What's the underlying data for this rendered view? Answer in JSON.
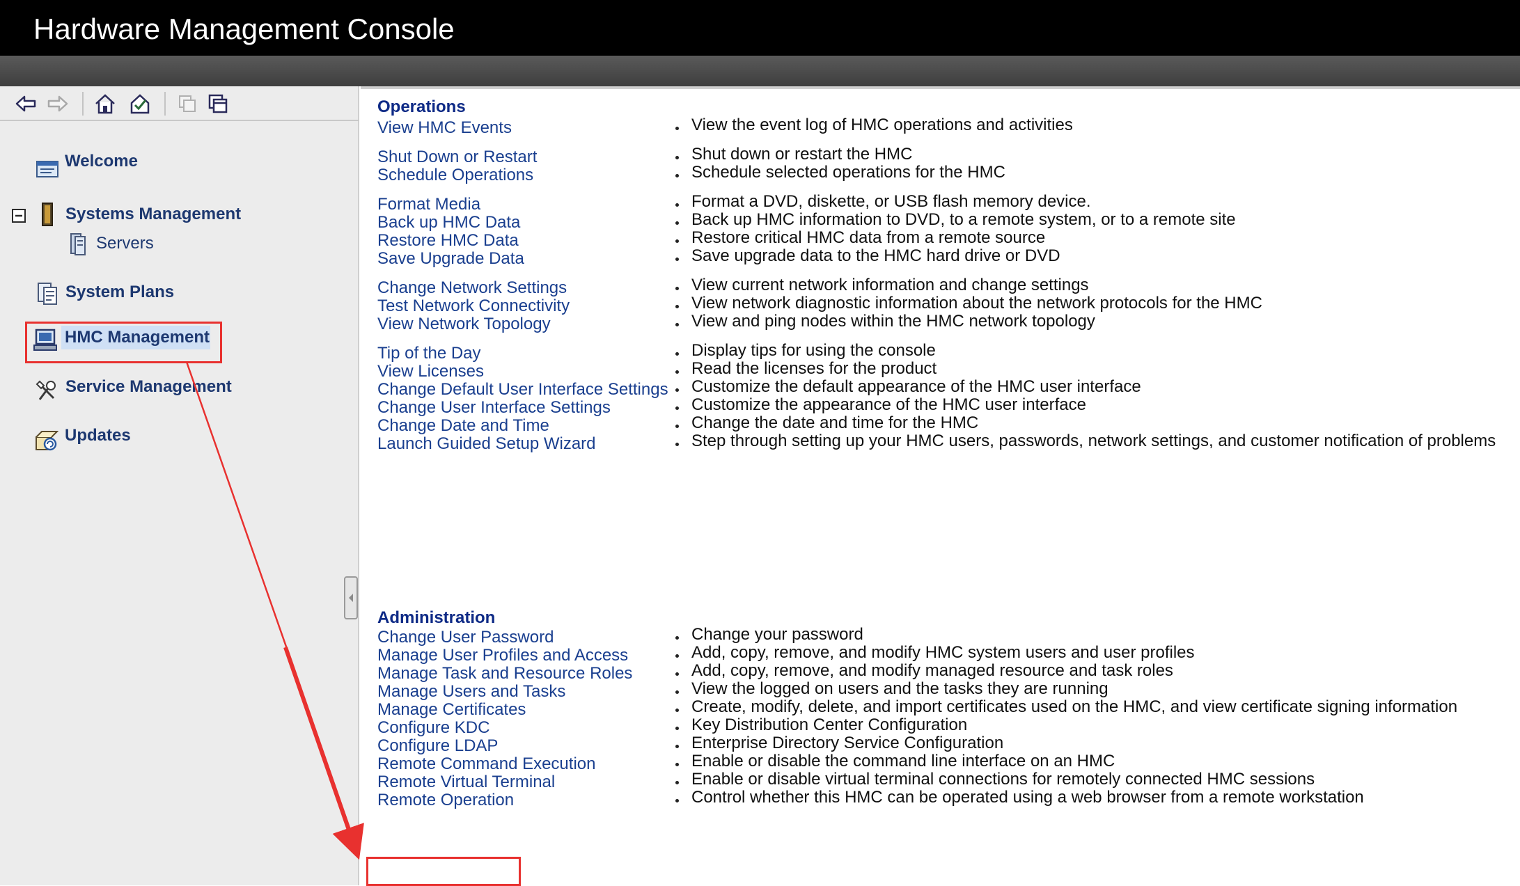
{
  "window": {
    "title": "Hardware Management Console"
  },
  "toolbar": {
    "icons": [
      "back-arrow-icon",
      "forward-arrow-icon",
      "home-icon",
      "favorites-check-icon",
      "tile-windows-icon",
      "cascade-windows-icon"
    ]
  },
  "sidebar": {
    "welcome": "Welcome",
    "systems_management": "Systems Management",
    "servers": "Servers",
    "system_plans": "System Plans",
    "hmc_management": "HMC Management",
    "service_management": "Service Management",
    "updates": "Updates",
    "selected": "HMC Management"
  },
  "operations": {
    "heading": "Operations",
    "groups": [
      [
        {
          "task": "View HMC Events",
          "desc": "View the event log of HMC operations and activities"
        }
      ],
      [
        {
          "task": "Shut Down or Restart",
          "desc": "Shut down or restart the HMC"
        },
        {
          "task": "Schedule Operations",
          "desc": "Schedule selected operations for the HMC"
        }
      ],
      [
        {
          "task": "Format Media",
          "desc": "Format a DVD, diskette, or USB flash memory device."
        },
        {
          "task": "Back up HMC Data",
          "desc": "Back up HMC information to DVD, to a remote system, or to a remote site"
        },
        {
          "task": "Restore HMC Data",
          "desc": "Restore critical HMC data from a remote source"
        },
        {
          "task": "Save Upgrade Data",
          "desc": "Save upgrade data to the HMC hard drive or DVD"
        }
      ],
      [
        {
          "task": "Change Network Settings",
          "desc": "View current network information and change settings"
        },
        {
          "task": "Test Network Connectivity",
          "desc": "View network diagnostic information about the network protocols for the HMC"
        },
        {
          "task": "View Network Topology",
          "desc": "View and ping nodes within the HMC network topology"
        }
      ],
      [
        {
          "task": "Tip of the Day",
          "desc": "Display tips for using the console"
        },
        {
          "task": "View Licenses",
          "desc": "Read the licenses for the product"
        },
        {
          "task": "Change Default User Interface Settings",
          "desc": "Customize the default appearance of the HMC user interface"
        },
        {
          "task": "Change User Interface Settings",
          "desc": "Customize the appearance of the HMC user interface"
        },
        {
          "task": "Change Date and Time",
          "desc": "Change the date and time for the HMC"
        },
        {
          "task": "Launch Guided Setup Wizard",
          "desc": "Step through setting up your HMC users, passwords, network settings, and customer notification of problems"
        }
      ]
    ]
  },
  "administration": {
    "heading": "Administration",
    "items": [
      {
        "task": "Change User Password",
        "desc": "Change your password"
      },
      {
        "task": "Manage User Profiles and Access",
        "desc": "Add, copy, remove, and modify HMC system users and user profiles"
      },
      {
        "task": "Manage Task and Resource Roles",
        "desc": "Add, copy, remove, and modify managed resource and task roles"
      },
      {
        "task": "Manage Users and Tasks",
        "desc": "View the logged on users and the tasks they are running"
      },
      {
        "task": "Manage Certificates",
        "desc": "Create, modify, delete, and import certificates used on the HMC, and view certificate signing information"
      },
      {
        "task": "Configure KDC",
        "desc": "Key Distribution Center Configuration"
      },
      {
        "task": "Configure LDAP",
        "desc": "Enterprise Directory Service Configuration"
      },
      {
        "task": "Remote Command Execution",
        "desc": "Enable or disable the command line interface on an HMC"
      },
      {
        "task": "Remote Virtual Terminal",
        "desc": "Enable or disable virtual terminal connections for remotely connected HMC sessions"
      },
      {
        "task": "Remote Operation",
        "desc": "Control whether this HMC can be operated using a web browser from a remote workstation"
      }
    ]
  },
  "annotation": {
    "color": "#e8312f",
    "highlighted_task": "Remote Operation"
  },
  "colors": {
    "link": "#1a3f8f",
    "heading": "#0e2a86",
    "nav": "#1d3870",
    "titlebar": "#000000"
  }
}
